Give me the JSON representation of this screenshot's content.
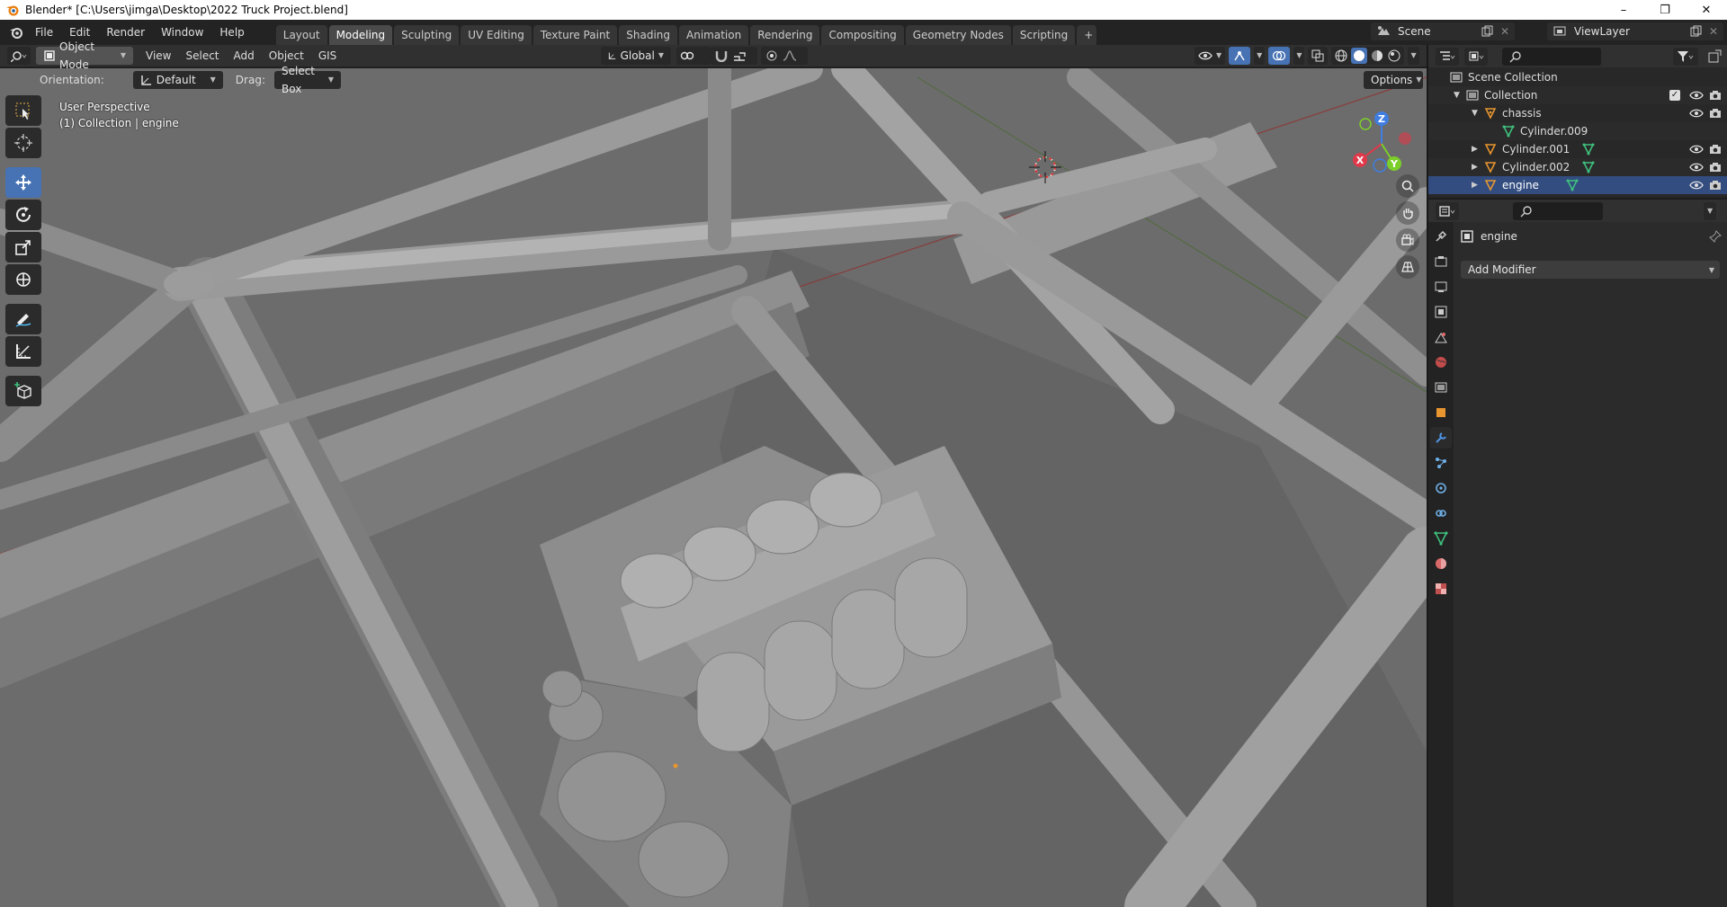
{
  "window": {
    "title": "Blender* [C:\\Users\\jimga\\Desktop\\2022 Truck Project.blend]",
    "controls": [
      "–",
      "❐",
      "✕"
    ]
  },
  "menu": [
    "File",
    "Edit",
    "Render",
    "Window",
    "Help"
  ],
  "workspaces": {
    "tabs": [
      "Layout",
      "Modeling",
      "Sculpting",
      "UV Editing",
      "Texture Paint",
      "Shading",
      "Animation",
      "Rendering",
      "Compositing",
      "Geometry Nodes",
      "Scripting"
    ],
    "active": "Modeling",
    "add": "+"
  },
  "scene": {
    "name": "Scene"
  },
  "view_layer": {
    "name": "ViewLayer"
  },
  "viewport_header": {
    "mode": "Object Mode",
    "menus": [
      "View",
      "Select",
      "Add",
      "Object",
      "GIS"
    ],
    "transform_orientation": "Global"
  },
  "tool_settings": {
    "orientation_label": "Orientation:",
    "orientation_value": "Default",
    "drag_label": "Drag:",
    "drag_value": "Select Box",
    "options_label": "Options"
  },
  "viewport_overlay": {
    "line1": "User Perspective",
    "line2": "(1) Collection | engine"
  },
  "gizmo": {
    "x": "X",
    "y": "Y",
    "z": "Z"
  },
  "outliner": {
    "root": "Scene Collection",
    "rows": [
      {
        "name": "Collection"
      },
      {
        "name": "chassis"
      },
      {
        "name": "Cylinder.009"
      },
      {
        "name": "Cylinder.001"
      },
      {
        "name": "Cylinder.002"
      },
      {
        "name": "engine"
      }
    ]
  },
  "properties": {
    "object_name": "engine",
    "add_modifier_label": "Add Modifier"
  },
  "colors": {
    "accent": "#4772b3",
    "object_orange": "#e8962f",
    "mesh_green": "#3fc07d",
    "axis_x": "#e0394a",
    "axis_y": "#7ccf2a",
    "axis_z": "#3f7de0"
  }
}
